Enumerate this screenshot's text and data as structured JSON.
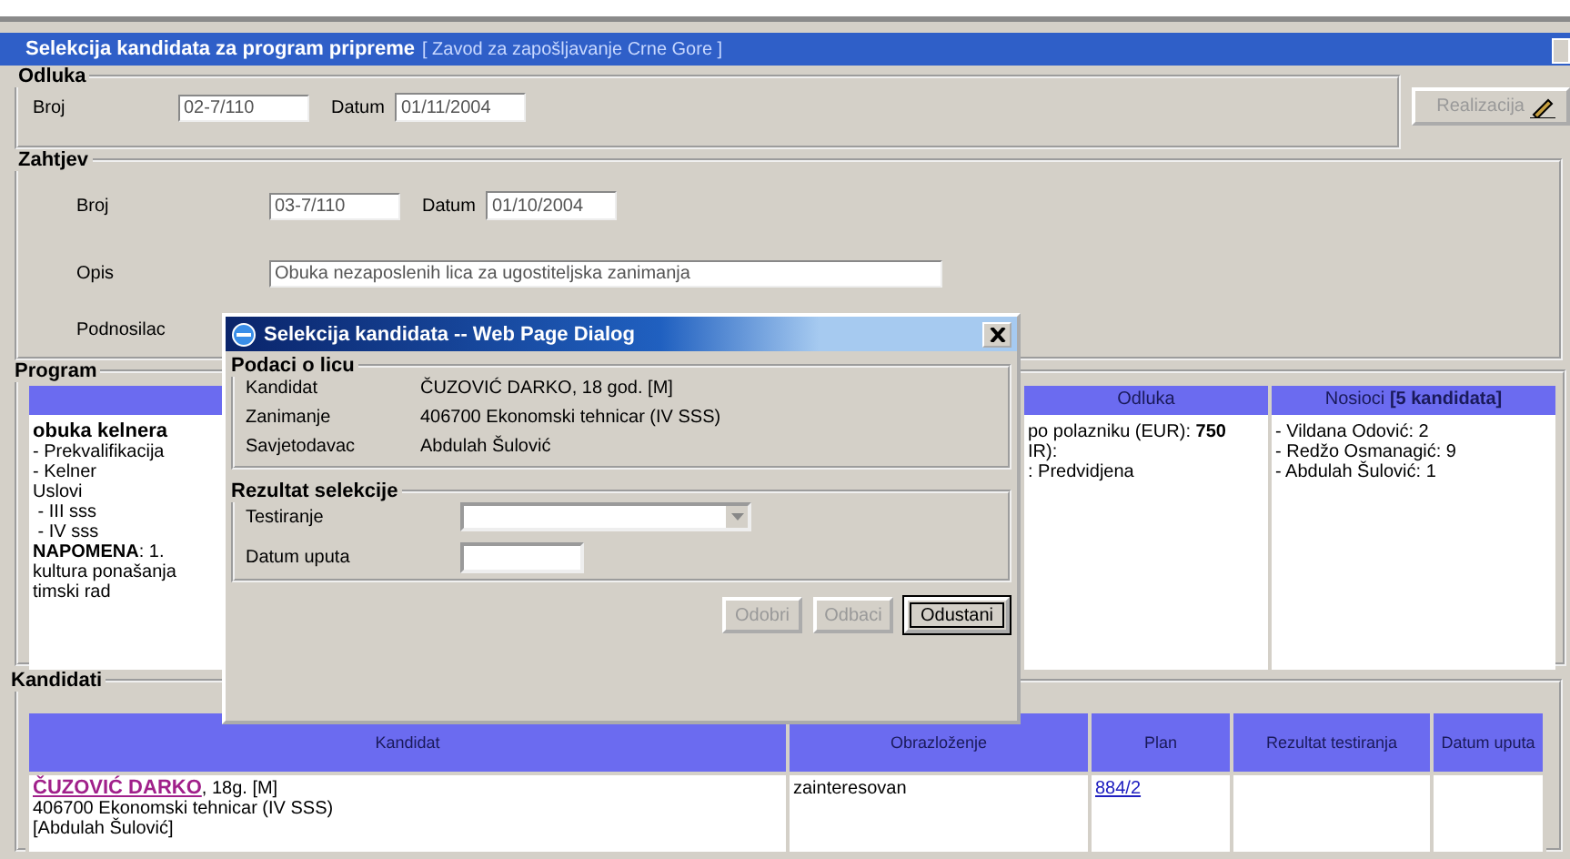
{
  "window": {
    "title": "Selekcija kandidata za program pripreme",
    "subtitle": "[ Zavod za zapošljavanje Crne Gore ]"
  },
  "odluka": {
    "legend": "Odluka",
    "fields": [
      {
        "label": "Broj",
        "value": "02-7/110"
      },
      {
        "label": "Datum",
        "value": "01/11/2004"
      }
    ],
    "button": {
      "label": "Realizacija",
      "disabled": true
    }
  },
  "zahtjev": {
    "legend": "Zahtjev",
    "fields": [
      {
        "label": "Broj",
        "value": "03-7/110"
      },
      {
        "label": "Datum",
        "value": "01/10/2004"
      }
    ],
    "opis": {
      "label": "Opis",
      "value": "Obuka nezaposlenih lica za ugostiteljska zanimanja"
    },
    "podnosilac": {
      "label": "Podnosilac"
    }
  },
  "program": {
    "legend": "Program",
    "columns": [
      {
        "lines": [
          {
            "text": "obuka kelnera",
            "kind": "title"
          },
          {
            "text": "- Prekvalifikacija",
            "kind": "plain"
          },
          {
            "text": "- Kelner",
            "kind": "plain"
          },
          {
            "text": "Uslovi",
            "kind": "plain"
          },
          {
            "text": " - III sss",
            "kind": "plain"
          },
          {
            "text": " - IV sss",
            "kind": "plain"
          },
          {
            "text": "**NAPOMENA**: 1.",
            "kind": "plain"
          },
          {
            "text": "kultura ponašanja",
            "kind": "plain"
          },
          {
            "text": "timski rad",
            "kind": "plain"
          }
        ]
      },
      {
        "header": "Odluka",
        "lines": [
          {
            "text": "po polazniku (EUR): **750**",
            "kind": "plain"
          },
          {
            "text": "IR):",
            "kind": "plain"
          },
          {
            "text": ": Predvidjena",
            "kind": "plain"
          }
        ]
      },
      {
        "header": "Nosioci **[5 kandidata]**",
        "lines": [
          {
            "text": "- Vildana Odović: 2",
            "kind": "plain"
          },
          {
            "text": "- Redžo Osmanagić: 9",
            "kind": "plain"
          },
          {
            "text": "- Abdulah Šulović: 1",
            "kind": "plain"
          }
        ]
      }
    ]
  },
  "kandidati": {
    "legend": "Kandidati",
    "columns": [
      "Kandidat",
      "Obrazloženje",
      "Plan",
      "Rezultat testiranja",
      "Datum uputa"
    ],
    "rows": [
      {
        "name": "ČUZOVIĆ DARKO",
        "info": ", 18g. [M]",
        "lines": [
          "406700 Ekonomski tehnicar (IV SSS)",
          "[Abdulah Šulović]"
        ],
        "obrazlozenje": "zainteresovan",
        "plan": "884/2"
      }
    ]
  },
  "dialog": {
    "title": "Selekcija kandidata -- Web Page Dialog",
    "person": {
      "legend": "Podaci o licu",
      "rows": [
        {
          "label": "Kandidat",
          "value": "ČUZOVIĆ DARKO, 18 god. [M]"
        },
        {
          "label": "Zanimanje",
          "value": "406700 Ekonomski tehnicar (IV SSS)"
        },
        {
          "label": "Savjetodavac",
          "value": "Abdulah Šulović"
        }
      ]
    },
    "result": {
      "legend": "Rezultat selekcije",
      "fields": [
        {
          "label": "Testiranje",
          "kind": "select"
        },
        {
          "label": "Datum uputa",
          "kind": "text"
        }
      ]
    },
    "buttons": [
      {
        "label": "Odobri",
        "disabled": true,
        "focused": false
      },
      {
        "label": "Odbaci",
        "disabled": true,
        "focused": false
      },
      {
        "label": "Odustani",
        "disabled": false,
        "focused": true
      }
    ]
  }
}
